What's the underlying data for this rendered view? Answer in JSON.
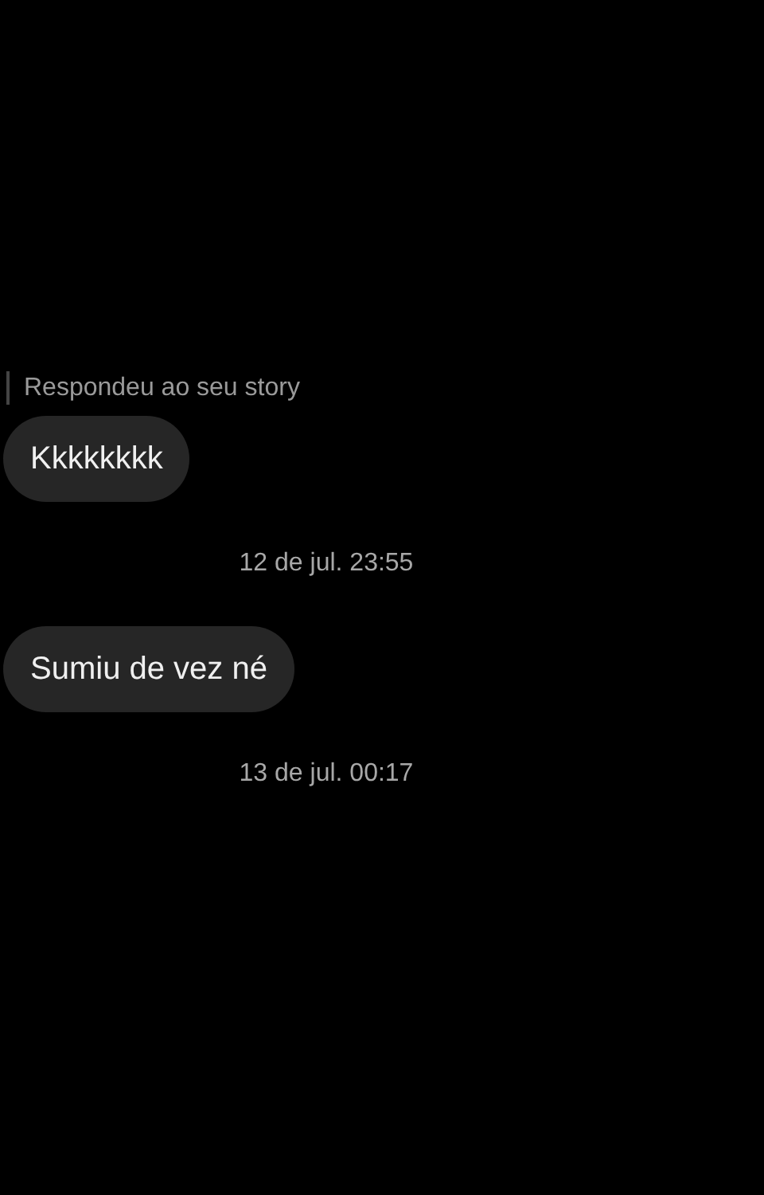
{
  "messages": [
    {
      "kind": "reply_label",
      "text": "Respondeu ao seu story"
    },
    {
      "kind": "message",
      "text": "Kkkkkkkk"
    },
    {
      "kind": "timestamp",
      "text": "12 de jul. 23:55"
    },
    {
      "kind": "message",
      "text": "Sumiu de vez né"
    },
    {
      "kind": "timestamp",
      "text": "13 de jul. 00:17"
    }
  ]
}
